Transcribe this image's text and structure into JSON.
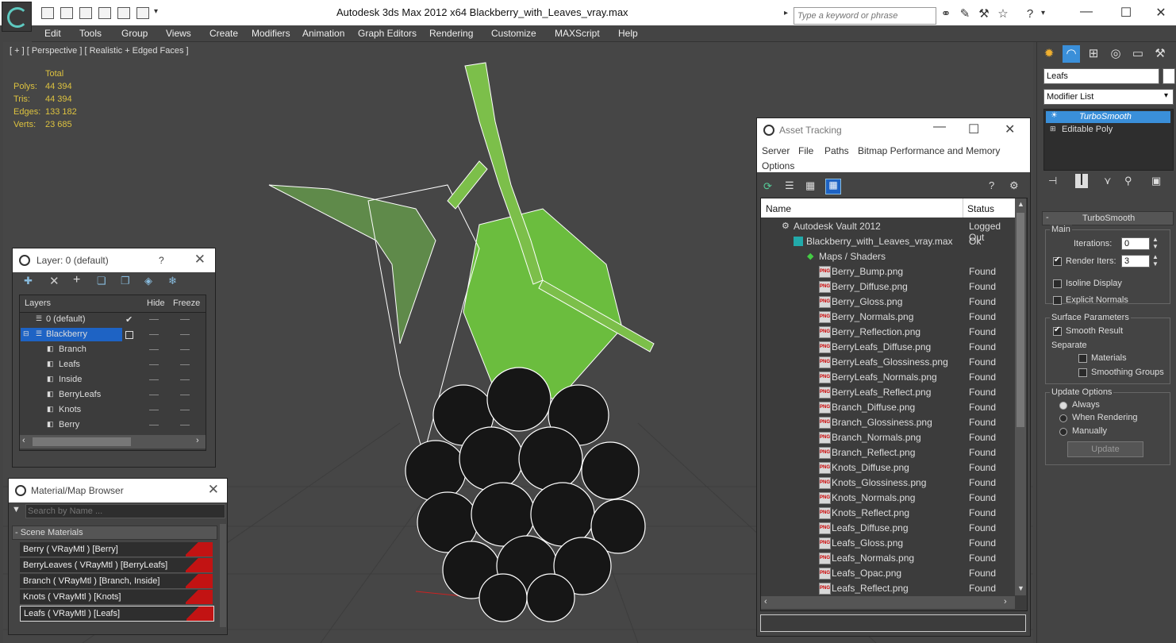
{
  "window": {
    "app_title": "Autodesk 3ds Max  2012 x64      Blackberry_with_Leaves_vray.max",
    "search_placeholder": "Type a keyword or phrase"
  },
  "menu": [
    "Edit",
    "Tools",
    "Group",
    "Views",
    "Create",
    "Modifiers",
    "Animation",
    "Graph Editors",
    "Rendering",
    "Customize",
    "MAXScript",
    "Help"
  ],
  "viewport": {
    "label": "[ + ] [ Perspective ] [ Realistic + Edged Faces ]",
    "stats_header": "Total",
    "stats": [
      {
        "label": "Polys:",
        "value": "44 394"
      },
      {
        "label": "Tris:",
        "value": "44 394"
      },
      {
        "label": "Edges:",
        "value": "133 182"
      },
      {
        "label": "Verts:",
        "value": "23 685"
      }
    ]
  },
  "layer_panel": {
    "title": "Layer: 0 (default)",
    "help": "?",
    "col_layers": "Layers",
    "col_hide": "Hide",
    "col_freeze": "Freeze",
    "rows": [
      {
        "name": "0 (default)",
        "indent": 1,
        "active": true
      },
      {
        "name": "Blackberry",
        "indent": 1,
        "selected": true
      },
      {
        "name": "Branch",
        "indent": 2
      },
      {
        "name": "Leafs",
        "indent": 2
      },
      {
        "name": "Inside",
        "indent": 2
      },
      {
        "name": "BerryLeafs",
        "indent": 2
      },
      {
        "name": "Knots",
        "indent": 2
      },
      {
        "name": "Berry",
        "indent": 2
      }
    ]
  },
  "material_browser": {
    "title": "Material/Map Browser",
    "search_placeholder": "Search by Name ...",
    "section": "- Scene Materials",
    "items": [
      "Berry  ( VRayMtl ) [Berry]",
      "BerryLeaves  ( VRayMtl ) [BerryLeafs]",
      "Branch  ( VRayMtl ) [Branch, Inside]",
      "Knots  ( VRayMtl ) [Knots]",
      "Leafs  ( VRayMtl ) [Leafs]"
    ]
  },
  "asset_tracking": {
    "title": "Asset Tracking",
    "menu": [
      "Server",
      "File",
      "Paths",
      "Bitmap Performance and Memory",
      "Options"
    ],
    "col_name": "Name",
    "col_status": "Status",
    "rows": [
      {
        "name": "Autodesk Vault 2012",
        "status": "Logged Out",
        "level": 0,
        "icon": "vault"
      },
      {
        "name": "Blackberry_with_Leaves_vray.max",
        "status": "Ok",
        "level": 1,
        "icon": "max"
      },
      {
        "name": "Maps / Shaders",
        "status": "",
        "level": 2,
        "icon": "maps"
      },
      {
        "name": "Berry_Bump.png",
        "status": "Found",
        "level": 3,
        "icon": "png"
      },
      {
        "name": "Berry_Diffuse.png",
        "status": "Found",
        "level": 3,
        "icon": "png"
      },
      {
        "name": "Berry_Gloss.png",
        "status": "Found",
        "level": 3,
        "icon": "png"
      },
      {
        "name": "Berry_Normals.png",
        "status": "Found",
        "level": 3,
        "icon": "png"
      },
      {
        "name": "Berry_Reflection.png",
        "status": "Found",
        "level": 3,
        "icon": "png"
      },
      {
        "name": "BerryLeafs_Diffuse.png",
        "status": "Found",
        "level": 3,
        "icon": "png"
      },
      {
        "name": "BerryLeafs_Glossiness.png",
        "status": "Found",
        "level": 3,
        "icon": "png"
      },
      {
        "name": "BerryLeafs_Normals.png",
        "status": "Found",
        "level": 3,
        "icon": "png"
      },
      {
        "name": "BerryLeafs_Reflect.png",
        "status": "Found",
        "level": 3,
        "icon": "png"
      },
      {
        "name": "Branch_Diffuse.png",
        "status": "Found",
        "level": 3,
        "icon": "png"
      },
      {
        "name": "Branch_Glossiness.png",
        "status": "Found",
        "level": 3,
        "icon": "png"
      },
      {
        "name": "Branch_Normals.png",
        "status": "Found",
        "level": 3,
        "icon": "png"
      },
      {
        "name": "Branch_Reflect.png",
        "status": "Found",
        "level": 3,
        "icon": "png"
      },
      {
        "name": "Knots_Diffuse.png",
        "status": "Found",
        "level": 3,
        "icon": "png"
      },
      {
        "name": "Knots_Glossiness.png",
        "status": "Found",
        "level": 3,
        "icon": "png"
      },
      {
        "name": "Knots_Normals.png",
        "status": "Found",
        "level": 3,
        "icon": "png"
      },
      {
        "name": "Knots_Reflect.png",
        "status": "Found",
        "level": 3,
        "icon": "png"
      },
      {
        "name": "Leafs_Diffuse.png",
        "status": "Found",
        "level": 3,
        "icon": "png"
      },
      {
        "name": "Leafs_Gloss.png",
        "status": "Found",
        "level": 3,
        "icon": "png"
      },
      {
        "name": "Leafs_Normals.png",
        "status": "Found",
        "level": 3,
        "icon": "png"
      },
      {
        "name": "Leafs_Opac.png",
        "status": "Found",
        "level": 3,
        "icon": "png"
      },
      {
        "name": "Leafs_Reflect.png",
        "status": "Found",
        "level": 3,
        "icon": "png"
      }
    ]
  },
  "command_panel": {
    "object_name": "Leafs",
    "modifier_list": "Modifier List",
    "stack": [
      "TurboSmooth",
      "Editable Poly"
    ],
    "rollout_title": "TurboSmooth",
    "main": "Main",
    "iterations_label": "Iterations:",
    "iterations_value": "0",
    "render_iters_label": "Render Iters:",
    "render_iters_value": "3",
    "isoline": "Isoline Display",
    "explicit": "Explicit Normals",
    "surface": "Surface Parameters",
    "smooth_result": "Smooth Result",
    "separate": "Separate",
    "materials": "Materials",
    "smoothing_groups": "Smoothing Groups",
    "update_options": "Update Options",
    "always": "Always",
    "when_rendering": "When Rendering",
    "manually": "Manually",
    "update_button": "Update"
  },
  "colors": {
    "accent_blue": "#3a8fd9",
    "stats_yellow": "#ddc23f",
    "swatch_red": "#c21313"
  }
}
